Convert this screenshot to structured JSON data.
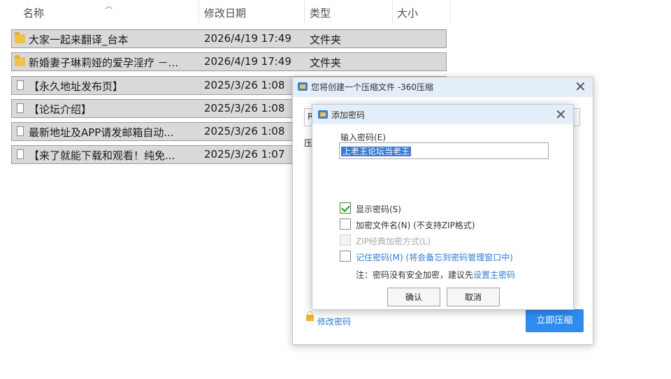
{
  "file_list": {
    "columns": {
      "name": "名称",
      "modified": "修改日期",
      "type": "类型",
      "size": "大小"
    },
    "rows": [
      {
        "icon": "folder-icon",
        "name": "大家一起来翻译_台本",
        "date": "2026/4/19 17:49",
        "type": "文件夹"
      },
      {
        "icon": "folder-icon",
        "name": "新婚妻子琳莉娅的爱孕淫疗 －...",
        "date": "2026/4/19 17:49",
        "type": "文件夹"
      },
      {
        "icon": "file-icon",
        "name": "【永久地址发布页】",
        "date": "2025/3/26 1:08",
        "type": ""
      },
      {
        "icon": "file-icon",
        "name": "【论坛介绍】",
        "date": "2025/3/26 1:08",
        "type": ""
      },
      {
        "icon": "file-icon",
        "name": "最新地址及APP请发邮箱自动...",
        "date": "2025/3/26 1:08",
        "type": ""
      },
      {
        "icon": "file-icon",
        "name": "【来了就能下载和观看！纯免...",
        "date": "2025/3/26 1:07",
        "type": ""
      }
    ]
  },
  "zip_dialog": {
    "title": "您将创建一个压缩文件 -360压缩",
    "path_prefix": "R",
    "label_partial": "压",
    "modify_password": "修改密码",
    "compress_now": "立即压缩"
  },
  "password_dialog": {
    "title": "添加密码",
    "input_label": "输入密码(E)",
    "password_value": "上老王论坛当老王",
    "options": [
      {
        "label": "显示密码(S)",
        "checked": true,
        "disabled": false
      },
      {
        "label": "加密文件名(N) (不支持ZIP格式)",
        "checked": false,
        "disabled": false
      },
      {
        "label": "ZIP经典加密方式(L)",
        "checked": false,
        "disabled": true
      },
      {
        "label": "记住密码(M) (将会备忘到密码管理窗口中)",
        "checked": false,
        "disabled": false
      }
    ],
    "note_prefix": "注：密码没有安全加密，建议先",
    "note_link": "设置主密码",
    "ok": "确认",
    "cancel": "取消"
  }
}
